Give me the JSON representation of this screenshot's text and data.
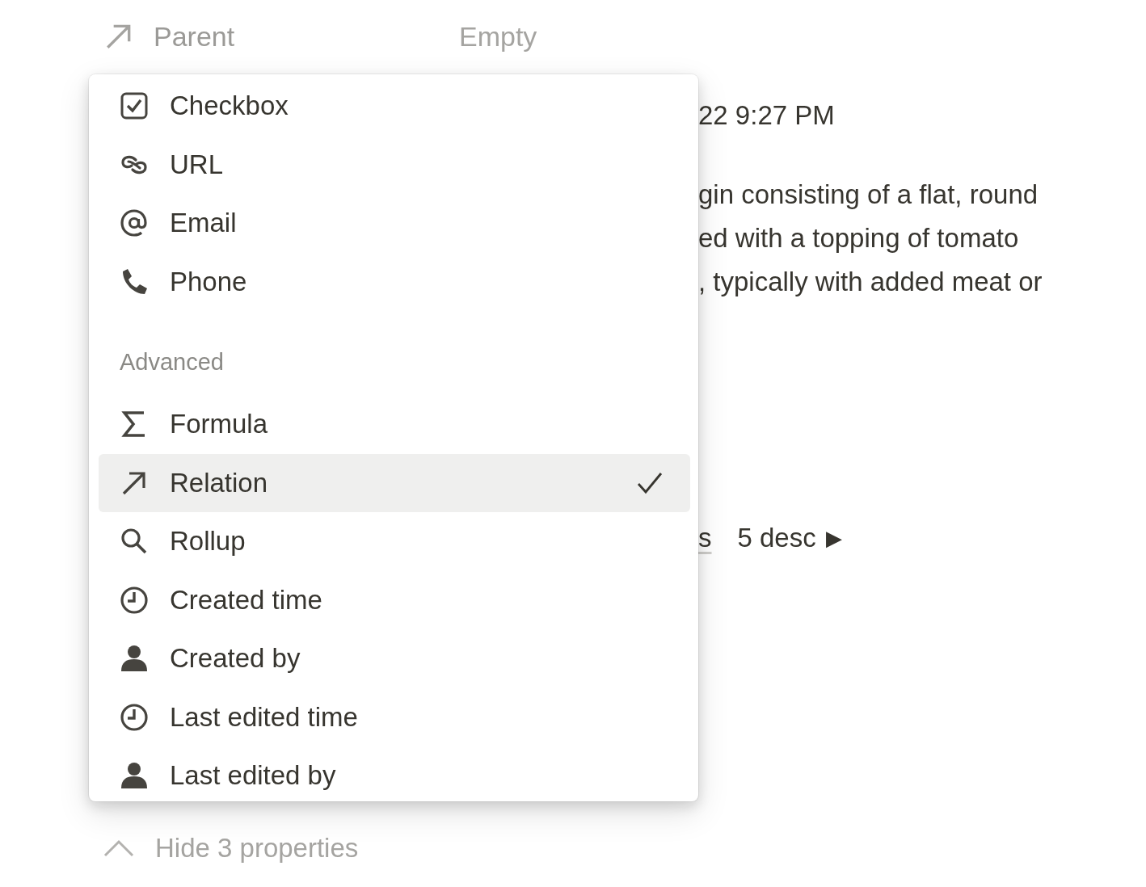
{
  "property": {
    "label": "Parent",
    "value": "Empty"
  },
  "background": {
    "date": "22 9:27 PM",
    "description_lines": [
      "gin consisting of a flat, round",
      "ed with a topping of tomato",
      ", typically with added meat or"
    ],
    "sort_link": "s",
    "sort_info": "5 desc",
    "sort_arrow": "▶"
  },
  "menu": {
    "items": [
      {
        "kind": "item",
        "label": "Checkbox",
        "selected": false
      },
      {
        "kind": "item",
        "label": "URL",
        "selected": false
      },
      {
        "kind": "item",
        "label": "Email",
        "selected": false
      },
      {
        "kind": "item",
        "label": "Phone",
        "selected": false
      },
      {
        "kind": "header",
        "label": "Advanced"
      },
      {
        "kind": "item",
        "label": "Formula",
        "selected": false
      },
      {
        "kind": "item",
        "label": "Relation",
        "selected": true
      },
      {
        "kind": "item",
        "label": "Rollup",
        "selected": false
      },
      {
        "kind": "item",
        "label": "Created time",
        "selected": false
      },
      {
        "kind": "item",
        "label": "Created by",
        "selected": false
      },
      {
        "kind": "item",
        "label": "Last edited time",
        "selected": false
      },
      {
        "kind": "item",
        "label": "Last edited by",
        "selected": false
      }
    ]
  },
  "toggle": {
    "label": "Hide 3 properties"
  }
}
